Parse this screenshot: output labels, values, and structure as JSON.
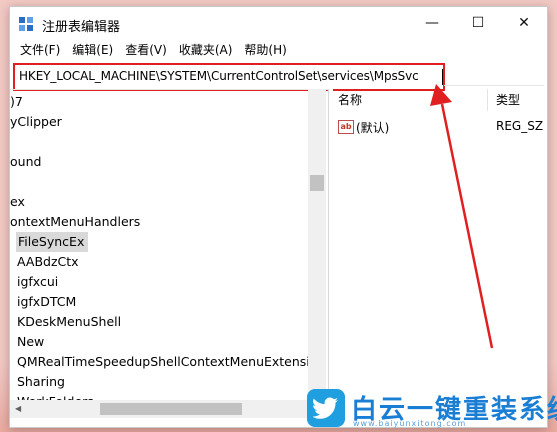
{
  "window": {
    "title": "注册表编辑器"
  },
  "window_controls": {
    "minimize": "—",
    "maximize": "☐",
    "close": "✕"
  },
  "menu": [
    "文件(F)",
    "编辑(E)",
    "查看(V)",
    "收藏夹(A)",
    "帮助(H)"
  ],
  "address_bar": {
    "value": "HKEY_LOCAL_MACHINE\\SYSTEM\\CurrentControlSet\\services\\MpsSvc"
  },
  "tree": [
    {
      "label": ")7"
    },
    {
      "label": "yClipper"
    },
    {
      "label": ""
    },
    {
      "label": "ound"
    },
    {
      "label": ""
    },
    {
      "label": "ex"
    },
    {
      "label": "ontextMenuHandlers"
    },
    {
      "label": "FileSyncEx",
      "selected": true
    },
    {
      "label": "AABdzCtx"
    },
    {
      "label": "igfxcui"
    },
    {
      "label": "igfxDTCM"
    },
    {
      "label": "KDeskMenuShell"
    },
    {
      "label": "New"
    },
    {
      "label": "QMRealTimeSpeedupShellContextMenuExtension"
    },
    {
      "label": "Sharing"
    },
    {
      "label": "WorkFolders"
    }
  ],
  "values_pane": {
    "columns": [
      "名称",
      "类型"
    ],
    "rows": [
      {
        "name": "(默认)",
        "type": "REG_SZ",
        "icon": "ab-icon"
      }
    ]
  },
  "watermark": {
    "brand": "白云一键重装系统",
    "url": "www.baiyunxitong.com"
  },
  "colors": {
    "highlight": "#e02020",
    "brand": "#1a7fd4"
  }
}
